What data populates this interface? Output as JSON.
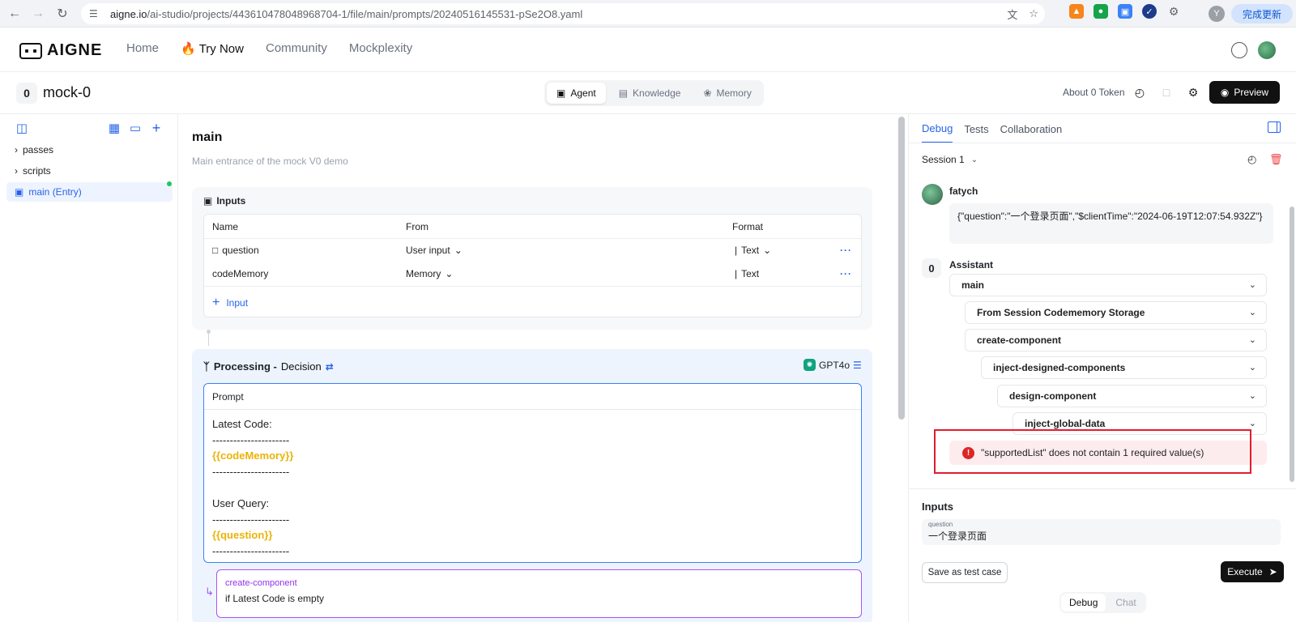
{
  "browser": {
    "url_host": "aigne.io",
    "url_path": "/ai-studio/projects/443610478048968704-1/file/main/prompts/20240516145531-pSe2O8.yaml",
    "update_label": "完成更新",
    "profile_initial": "Y"
  },
  "topnav": {
    "logo": "AIGNE",
    "links": [
      "Home",
      "Try Now",
      "Community",
      "Mockplexity"
    ]
  },
  "project": {
    "icon": "0",
    "name": "mock-0",
    "tabs": [
      "Agent",
      "Knowledge",
      "Memory"
    ],
    "token_text": "About 0 Token",
    "preview_label": "Preview"
  },
  "sidebar": {
    "items": [
      "passes",
      "scripts",
      "main (Entry)"
    ]
  },
  "main": {
    "title": "main",
    "description": "Main entrance of the mock V0 demo",
    "inputs": {
      "title": "Inputs",
      "headers": [
        "Name",
        "From",
        "Format"
      ],
      "rows": [
        {
          "name": "question",
          "from": "User input",
          "format": "Text"
        },
        {
          "name": "codeMemory",
          "from": "Memory",
          "format": "Text"
        }
      ],
      "add_label": "Input"
    },
    "processing": {
      "title": "Processing -",
      "type": "Decision",
      "model": "GPT4o",
      "prompt_label": "Prompt",
      "prompt_lines": [
        "Latest Code:",
        "----------------------",
        "{{codeMemory}}",
        "----------------------",
        "",
        "User Query:",
        "----------------------",
        "{{question}}",
        "----------------------"
      ],
      "branch": {
        "name": "create-component",
        "condition": "if Latest Code is empty"
      }
    }
  },
  "right": {
    "tabs": [
      "Debug",
      "Tests",
      "Collaboration"
    ],
    "session": "Session 1",
    "user_name": "fatych",
    "user_message": "{\"question\":\"一个登录页面\",\"$clientTime\":\"2024-06-19T12:07:54.932Z\"}",
    "assistant_name": "Assistant",
    "assistant_icon": "0",
    "steps": [
      "main",
      "From Session Codememory Storage",
      "create-component",
      "inject-designed-components",
      "design-component",
      "inject-global-data"
    ],
    "error": "\"supportedList\" does not contain 1 required value(s)",
    "inputs_title": "Inputs",
    "question_label": "question",
    "question_value": "一个登录页面",
    "save_label": "Save as test case",
    "execute_label": "Execute",
    "modes": [
      "Debug",
      "Chat"
    ]
  }
}
